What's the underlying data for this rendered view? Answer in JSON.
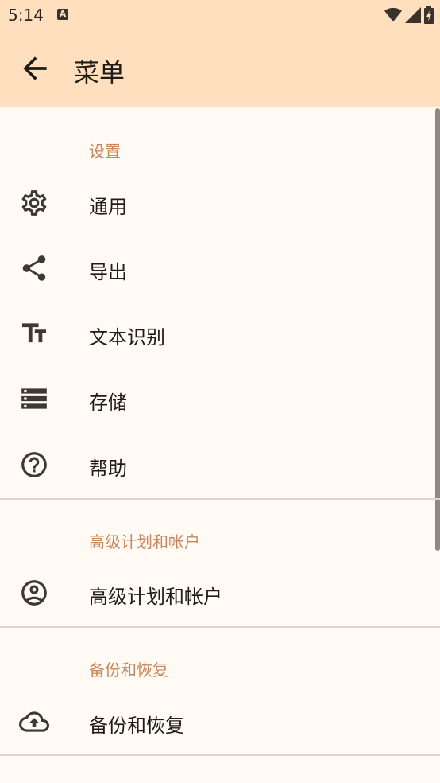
{
  "status_bar": {
    "time": "5:14",
    "notification_icon": "A"
  },
  "app_bar": {
    "title": "菜单",
    "back_icon": "arrow-back-icon"
  },
  "sections": {
    "settings": {
      "header": "设置",
      "items": [
        {
          "label": "通用",
          "icon": "gear-icon"
        },
        {
          "label": "导出",
          "icon": "share-icon"
        },
        {
          "label": "文本识别",
          "icon": "text-fields-icon"
        },
        {
          "label": "存储",
          "icon": "storage-icon"
        },
        {
          "label": "帮助",
          "icon": "help-icon"
        }
      ]
    },
    "premium": {
      "header": "高级计划和帐户",
      "items": [
        {
          "label": "高级计划和帐户",
          "icon": "account-circle-icon"
        }
      ]
    },
    "backup": {
      "header": "备份和恢复",
      "items": [
        {
          "label": "备份和恢复",
          "icon": "cloud-upload-icon"
        }
      ]
    }
  },
  "colors": {
    "app_bar_bg": "#ffdfbd",
    "page_bg": "#fffaf4",
    "section_header": "#c9865a",
    "icon": "#3d3833"
  }
}
